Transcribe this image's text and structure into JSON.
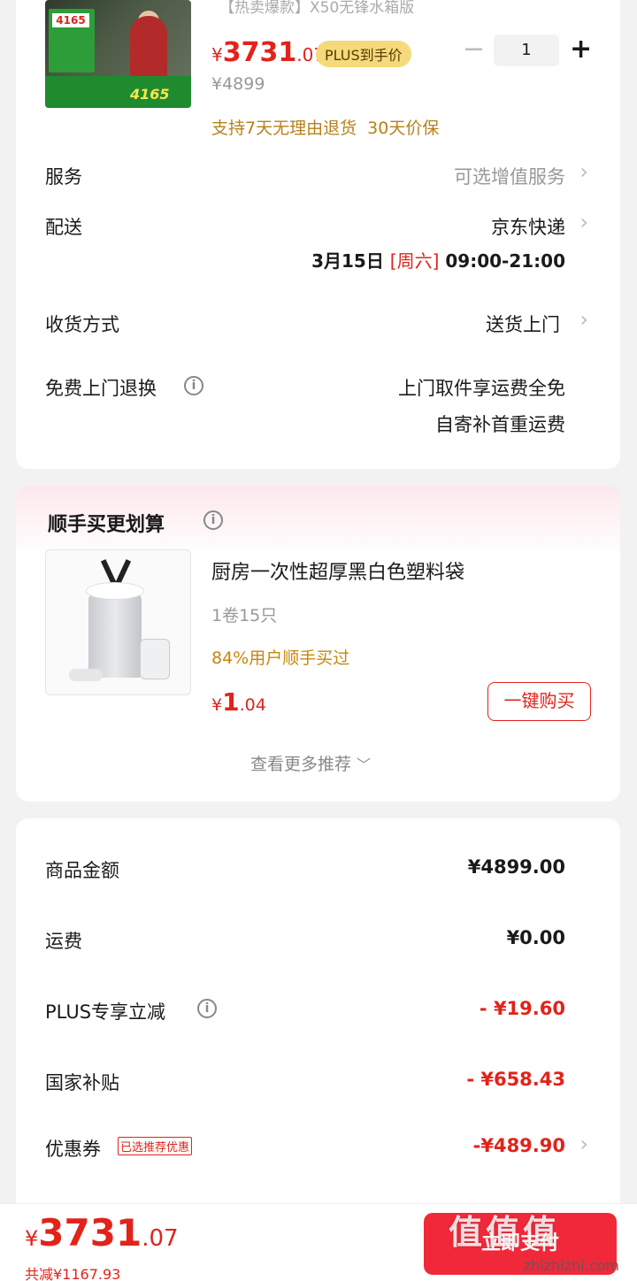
{
  "product": {
    "title_fragment": "【热卖爆款】X50无锋水箱版",
    "thumb_tag": "4165",
    "thumb_price": "4165",
    "price_symbol": "¥",
    "price_int": "3731",
    "price_dec": ".07",
    "plus_badge": "PLUS到手价",
    "original_price": "¥4899",
    "quantity": "1",
    "minus_label": "−",
    "plus_label": "+",
    "guarantee": "支持7天无理由退货  30天价保"
  },
  "rows": {
    "service_label": "服务",
    "service_value": "可选增值服务",
    "delivery_label": "配送",
    "delivery_value": "京东快递",
    "delivery_date": "3月15日",
    "delivery_weekday": "[周六]",
    "delivery_time": "09:00-21:00",
    "receive_label": "收货方式",
    "receive_value": "送货上门",
    "return_label": "免费上门退换",
    "return_line1": "上门取件享运费全免",
    "return_line2": "自寄补首重运费"
  },
  "addon": {
    "title": "顺手买更划算",
    "item_name": "厨房一次性超厚黑白色塑料袋",
    "item_spec": "1卷15只",
    "item_stat": "84%用户顺手买过",
    "price_symbol": "¥",
    "price_int": "1",
    "price_dec": ".04",
    "buy_label": "一键购买",
    "more_label": "查看更多推荐"
  },
  "summary": {
    "goods_label": "商品金额",
    "goods_value": "¥4899.00",
    "shipping_label": "运费",
    "shipping_value": "¥0.00",
    "plus_label": "PLUS专享立减",
    "plus_value": "- ¥19.60",
    "subsidy_label": "国家补贴",
    "subsidy_value": "- ¥658.43",
    "coupon_label": "优惠券",
    "coupon_tag": "已选推荐优惠",
    "coupon_value": "-¥489.90"
  },
  "bottom": {
    "price_symbol": "¥",
    "price_int": "3731",
    "price_dec": ".07",
    "total_saved": "共减¥1167.93",
    "pay_label": "立即支付"
  },
  "watermark": {
    "text": "值值值",
    "url": "zhizhizhi.com"
  },
  "colors": {
    "accent_red": "#e2231a",
    "pay_button": "#f0283a",
    "plus_gold": "#f5d97a"
  }
}
